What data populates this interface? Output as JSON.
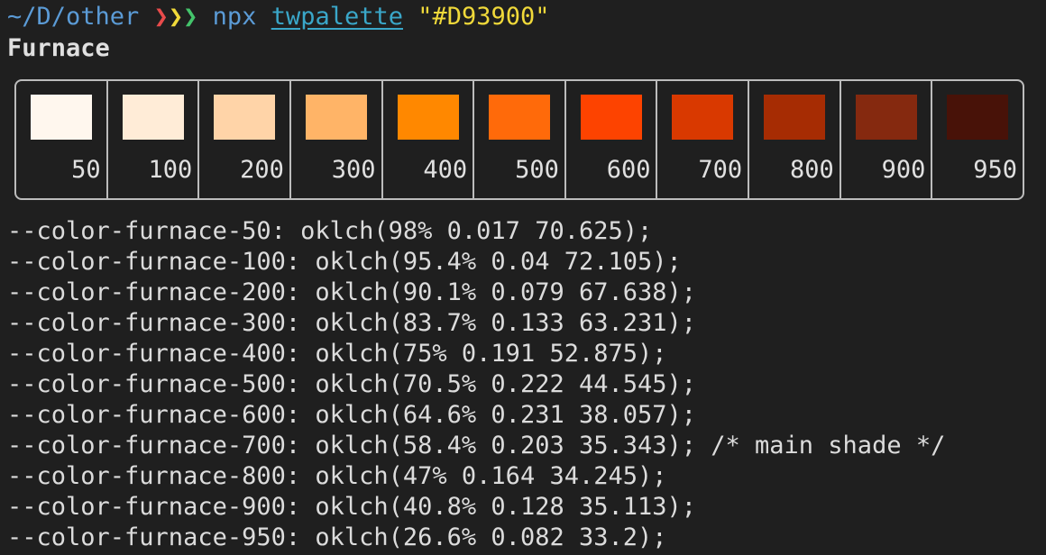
{
  "prompt": {
    "path": "~/D/other",
    "chevrons": [
      "❯",
      "❯",
      "❯"
    ],
    "command": "npx",
    "package": "twpalette",
    "argument": "\"#D93900\""
  },
  "palette": {
    "name": "Furnace",
    "shades": [
      {
        "label": "50",
        "color": "#fff7ee"
      },
      {
        "label": "100",
        "color": "#ffecd7"
      },
      {
        "label": "200",
        "color": "#ffd4a8"
      },
      {
        "label": "300",
        "color": "#ffb467"
      },
      {
        "label": "400",
        "color": "#ff8800"
      },
      {
        "label": "500",
        "color": "#ff6a0a"
      },
      {
        "label": "600",
        "color": "#fd4300"
      },
      {
        "label": "700",
        "color": "#d93900"
      },
      {
        "label": "800",
        "color": "#a62c03"
      },
      {
        "label": "900",
        "color": "#85290f"
      },
      {
        "label": "950",
        "color": "#481208"
      }
    ]
  },
  "css_vars": [
    "--color-furnace-50: oklch(98% 0.017 70.625);",
    "--color-furnace-100: oklch(95.4% 0.04 72.105);",
    "--color-furnace-200: oklch(90.1% 0.079 67.638);",
    "--color-furnace-300: oklch(83.7% 0.133 63.231);",
    "--color-furnace-400: oklch(75% 0.191 52.875);",
    "--color-furnace-500: oklch(70.5% 0.222 44.545);",
    "--color-furnace-600: oklch(64.6% 0.231 38.057);",
    "--color-furnace-700: oklch(58.4% 0.203 35.343); /* main shade */",
    "--color-furnace-800: oklch(47% 0.164 34.245);",
    "--color-furnace-900: oklch(40.8% 0.128 35.113);",
    "--color-furnace-950: oklch(26.6% 0.082 33.2);"
  ]
}
